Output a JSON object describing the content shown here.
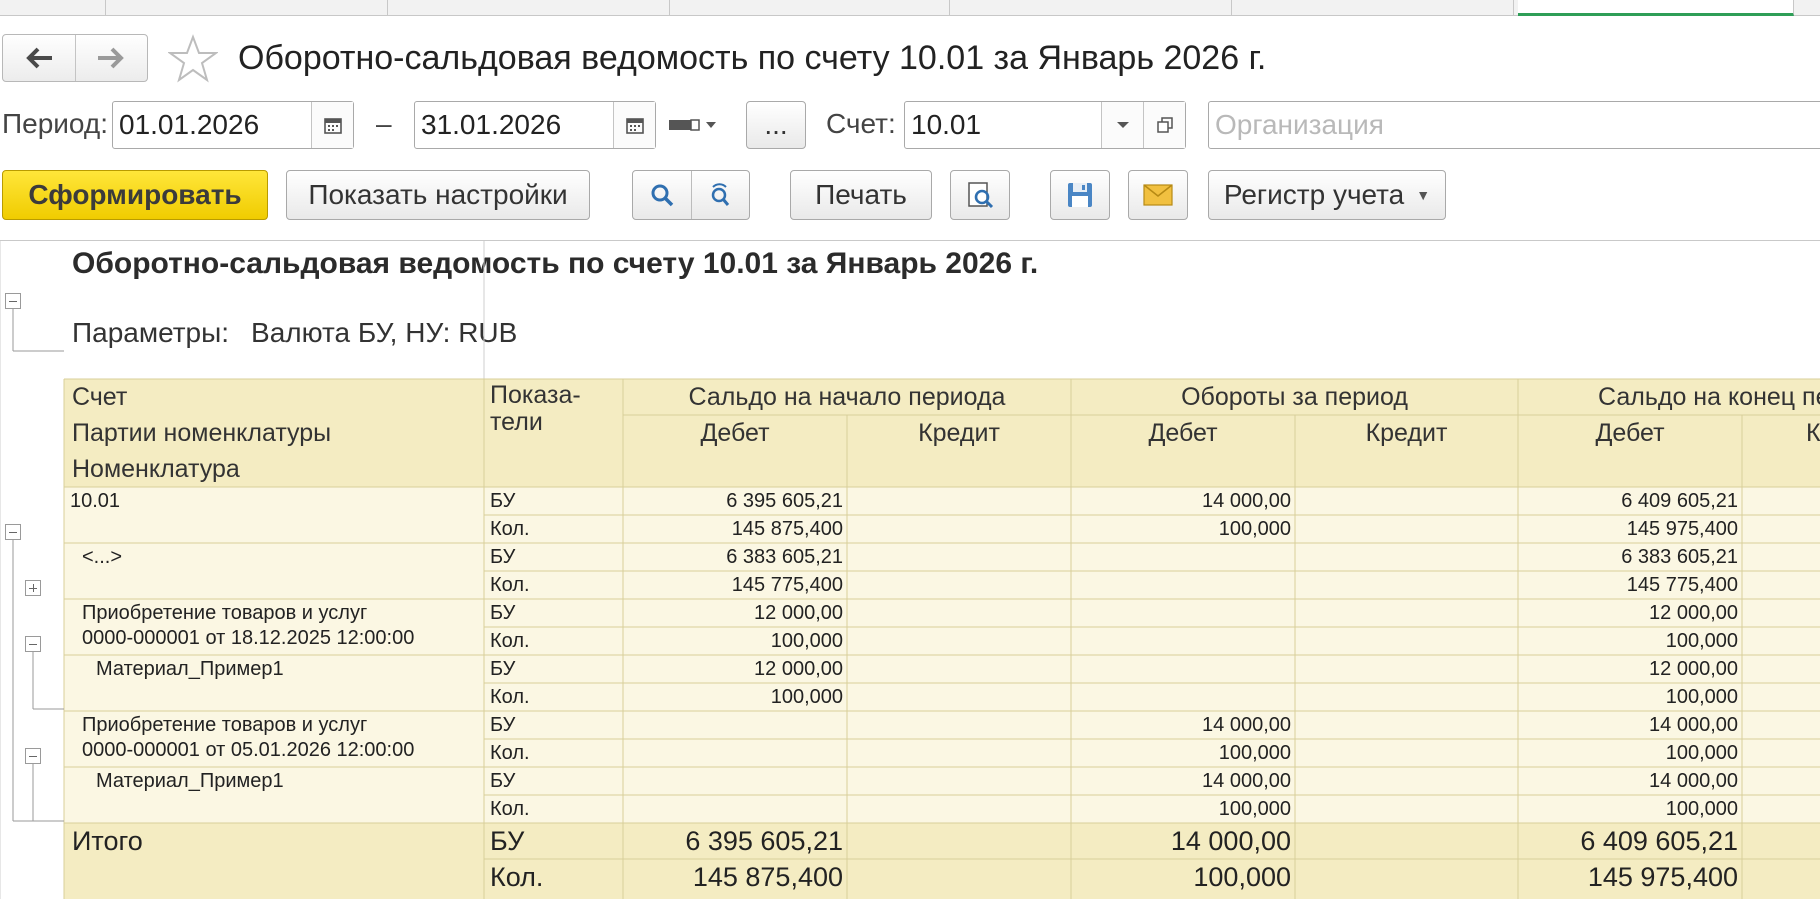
{
  "window": {
    "title": "Оборотно-сальдовая ведомость по счету 10.01 за Январь 2026 г."
  },
  "nav": {
    "back_icon": "arrow-left-icon",
    "forward_icon": "arrow-right-icon",
    "favorite_icon": "star-icon"
  },
  "filters": {
    "period_label": "Период:",
    "date_from": "01.01.2026",
    "dash": "–",
    "date_to": "31.01.2026",
    "ellipsis": "...",
    "account_label": "Счет:",
    "account_value": "10.01",
    "organization_placeholder": "Организация"
  },
  "toolbar": {
    "generate": "Сформировать",
    "show_settings": "Показать настройки",
    "print": "Печать",
    "register": "Регистр учета"
  },
  "report": {
    "title": "Оборотно-сальдовая ведомость по счету 10.01 за Январь 2026 г.",
    "params_label": "Параметры:",
    "params_value": "Валюта БУ, НУ: RUB",
    "header": {
      "account": "Счет",
      "batches": "Партии номенклатуры",
      "nomenclature": "Номенклатура",
      "indicator_1": "Показа-",
      "indicator_2": "тели",
      "opening": "Сальдо на начало периода",
      "turnover": "Обороты за период",
      "closing": "Сальдо на конец пе",
      "debit": "Дебет",
      "credit": "Кредит",
      "credit_cut": "К"
    },
    "rows": [
      {
        "name": "10.01",
        "ind": [
          "БУ",
          "Кол."
        ],
        "od": [
          "6 395 605,21",
          "145 875,400"
        ],
        "td": [
          "14 000,00",
          "100,000"
        ],
        "cd": [
          "6 409 605,21",
          "145 975,400"
        ]
      },
      {
        "name": "<...>",
        "ind": [
          "БУ",
          "Кол."
        ],
        "od": [
          "6 383 605,21",
          "145 775,400"
        ],
        "td": [
          "",
          ""
        ],
        "cd": [
          "6 383 605,21",
          "145 775,400"
        ]
      },
      {
        "name": "Приобретение товаров и услуг",
        "name2": "0000-000001 от 18.12.2025 12:00:00",
        "ind": [
          "БУ",
          "Кол."
        ],
        "od": [
          "12 000,00",
          "100,000"
        ],
        "td": [
          "",
          ""
        ],
        "cd": [
          "12 000,00",
          "100,000"
        ]
      },
      {
        "name": "Материал_Пример1",
        "ind": [
          "БУ",
          "Кол."
        ],
        "od": [
          "12 000,00",
          "100,000"
        ],
        "td": [
          "",
          ""
        ],
        "cd": [
          "12 000,00",
          "100,000"
        ]
      },
      {
        "name": "Приобретение товаров и услуг",
        "name2": "0000-000001 от 05.01.2026 12:00:00",
        "ind": [
          "БУ",
          "Кол."
        ],
        "od": [
          "",
          ""
        ],
        "td": [
          "14 000,00",
          "100,000"
        ],
        "cd": [
          "14 000,00",
          "100,000"
        ]
      },
      {
        "name": "Материал_Пример1",
        "ind": [
          "БУ",
          "Кол."
        ],
        "od": [
          "",
          ""
        ],
        "td": [
          "14 000,00",
          "100,000"
        ],
        "cd": [
          "14 000,00",
          "100,000"
        ]
      }
    ],
    "total": {
      "label": "Итого",
      "ind": [
        "БУ",
        "Кол."
      ],
      "od": [
        "6 395 605,21",
        "145 875,400"
      ],
      "td": [
        "14 000,00",
        "100,000"
      ],
      "cd": [
        "6 409 605,21",
        "145 975,400"
      ]
    }
  },
  "colors": {
    "header_bg": "#f4ecc2",
    "data_bg": "#fbf7e3",
    "grid": "#d8cf9a",
    "accent": "#ffd800"
  }
}
